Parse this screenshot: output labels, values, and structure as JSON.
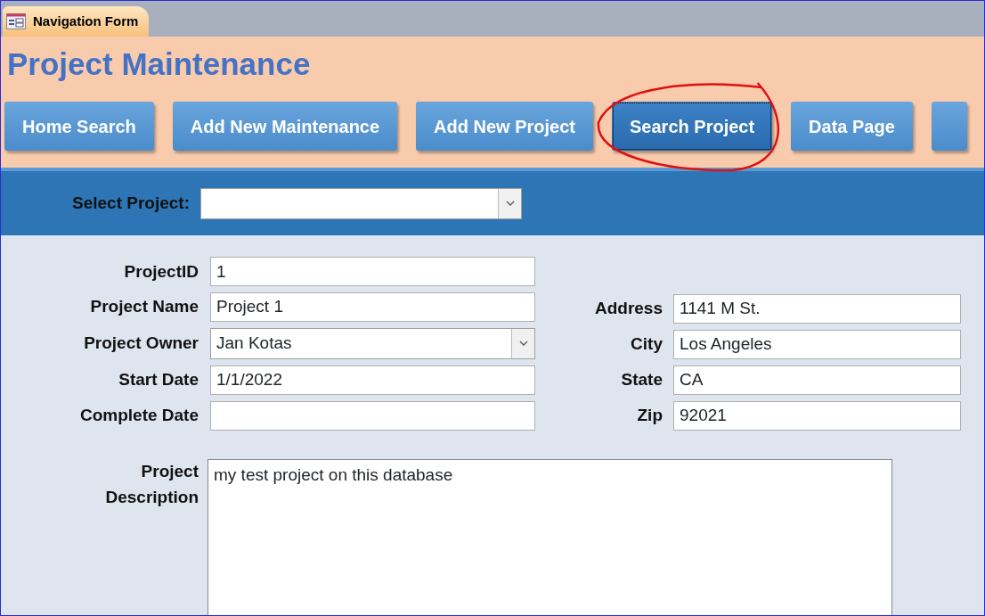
{
  "window": {
    "tab": {
      "label": "Navigation Form",
      "selected": true
    }
  },
  "title": "Project Maintenance",
  "nav_buttons": [
    {
      "label": "Home Search",
      "selected": false,
      "circled": false
    },
    {
      "label": "Add New Maintenance",
      "selected": false,
      "circled": false
    },
    {
      "label": "Add New Project",
      "selected": false,
      "circled": false
    },
    {
      "label": "Search Project",
      "selected": true,
      "circled": true
    },
    {
      "label": "Data Page",
      "selected": false,
      "circled": false
    },
    {
      "selected": false,
      "circled": false
    }
  ],
  "select_project": {
    "label": "Select Project:"
  },
  "left_fields": [
    {
      "label": "ProjectID",
      "value": "1",
      "kind": "text"
    },
    {
      "label": "Project Name",
      "value": "Project 1",
      "kind": "text"
    },
    {
      "label": "Project Owner",
      "value": "Jan Kotas",
      "kind": "combo"
    },
    {
      "label": "Start Date",
      "value": "1/1/2022",
      "kind": "text"
    },
    {
      "label": "Complete Date",
      "kind": "text"
    }
  ],
  "right_fields": [
    {
      "label": "Address",
      "value": "1141 M St."
    },
    {
      "label": "City",
      "value": "Los Angeles"
    },
    {
      "label": "State",
      "value": "CA"
    },
    {
      "label": "Zip",
      "value": "92021"
    }
  ],
  "description": {
    "label_lines": [
      "Project",
      "Description"
    ],
    "value": "my test project on this database"
  }
}
